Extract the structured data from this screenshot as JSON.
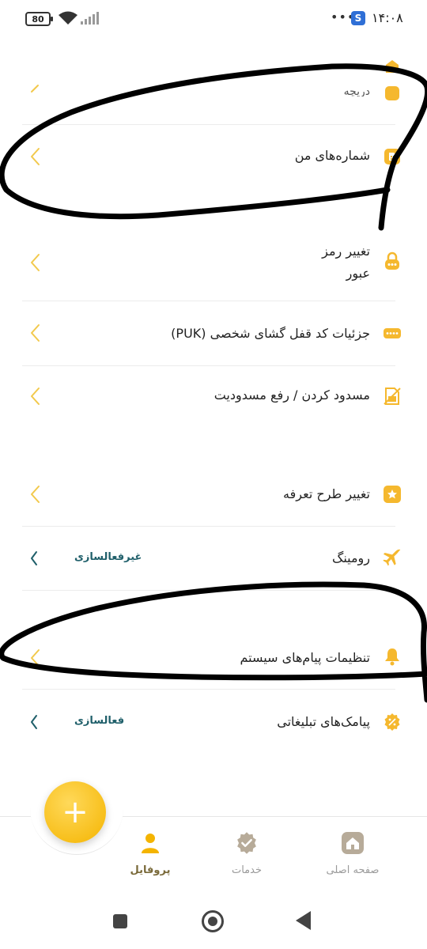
{
  "status_bar": {
    "battery": "80",
    "time": "۱۴:۰۸",
    "dots": "•••",
    "app_badge": "S"
  },
  "menu": {
    "partial_top_label": "دریچه",
    "items": [
      {
        "id": "my-numbers",
        "label": "شماره‌های من",
        "icon": "sim-card-icon"
      },
      {
        "id": "change-password",
        "label": "تغییر رمز عبور",
        "icon": "lock-icon"
      },
      {
        "id": "puk-details",
        "label": "جزئیات کد قفل گشای شخصی (PUK)",
        "icon": "pin-code-icon"
      },
      {
        "id": "block-unblock",
        "label": "مسدود کردن / رفع مسدودیت",
        "icon": "blocked-sim-icon"
      },
      {
        "id": "change-tariff",
        "label": "تغییر طرح تعرفه",
        "icon": "star-icon"
      },
      {
        "id": "roaming",
        "label": "رومینگ",
        "status": "غیرفعالسازی",
        "icon": "airplane-icon"
      },
      {
        "id": "system-messages",
        "label": "تنظیمات پیام‌های سیستم",
        "icon": "bell-icon"
      },
      {
        "id": "ad-sms",
        "label": "پیامک‌های تبلیغاتی",
        "status": "فعالسازی",
        "icon": "percent-icon"
      }
    ]
  },
  "password_label_line1": "تغییر رمز",
  "password_label_line2": "عبور",
  "nav": {
    "home": "صفحه اصلی",
    "services": "خدمات",
    "profile": "پروفایل",
    "fab": "+"
  },
  "colors": {
    "accent": "#f4b400",
    "chevron": "#f2c94c",
    "status_text": "#1f5f6a",
    "nav_active": "#7a6a3a"
  }
}
